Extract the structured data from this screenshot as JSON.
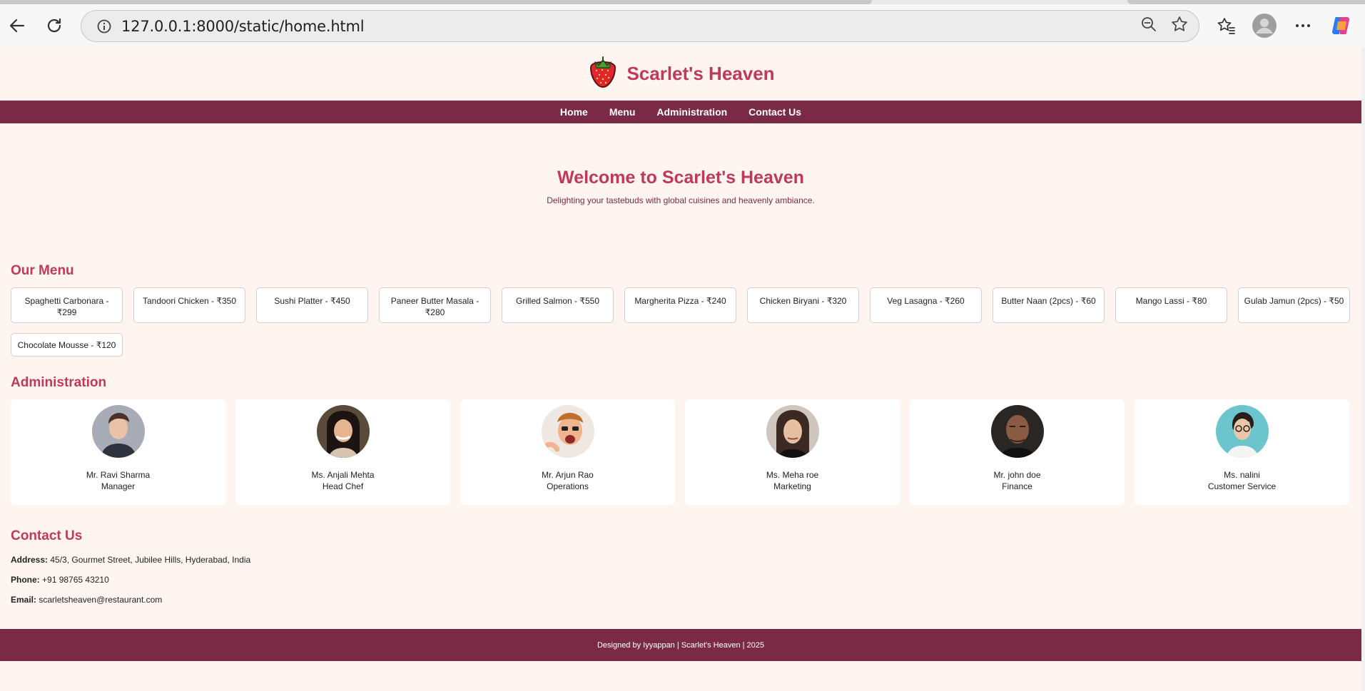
{
  "browser": {
    "url": "127.0.0.1:8000/static/home.html"
  },
  "site": {
    "brand": "Scarlet's Heaven",
    "nav": [
      "Home",
      "Menu",
      "Administration",
      "Contact Us"
    ],
    "hero_title": "Welcome to Scarlet's Heaven",
    "hero_subtitle": "Delighting your tastebuds with global cuisines and heavenly ambiance.",
    "menu_title": "Our Menu",
    "menu_items": [
      "Spaghetti Carbonara - ₹299",
      "Tandoori Chicken - ₹350",
      "Sushi Platter - ₹450",
      "Paneer Butter Masala - ₹280",
      "Grilled Salmon - ₹550",
      "Margherita Pizza - ₹240",
      "Chicken Biryani - ₹320",
      "Veg Lasagna - ₹260",
      "Butter Naan (2pcs) - ₹60",
      "Mango Lassi - ₹80",
      "Gulab Jamun (2pcs) - ₹50",
      "Chocolate Mousse - ₹120"
    ],
    "admin_title": "Administration",
    "staff": [
      {
        "name": "Mr. Ravi Sharma",
        "role": "Manager"
      },
      {
        "name": "Ms. Anjali Mehta",
        "role": "Head Chef"
      },
      {
        "name": "Mr. Arjun Rao",
        "role": "Operations"
      },
      {
        "name": "Ms. Meha roe",
        "role": "Marketing"
      },
      {
        "name": "Mr. john doe",
        "role": "Finance"
      },
      {
        "name": "Ms. nalini",
        "role": "Customer Service"
      }
    ],
    "contact_title": "Contact Us",
    "contact": {
      "address_label": "Address:",
      "address": "45/3, Gourmet Street, Jubilee Hills, Hyderabad, India",
      "phone_label": "Phone:",
      "phone": "+91 98765 43210",
      "email_label": "Email:",
      "email": "scarletsheaven@restaurant.com"
    },
    "footer": "Designed by Iyyappan | Scarlet's Heaven | 2025"
  },
  "colors": {
    "accent": "#c0395a",
    "nav_bg": "#7b2a45",
    "page_bg": "#fff5f0"
  }
}
